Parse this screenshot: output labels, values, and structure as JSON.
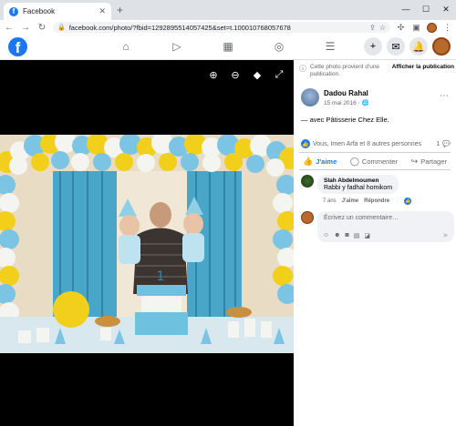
{
  "browser": {
    "tab_title": "Facebook",
    "tab_favicon": "f",
    "url": "facebook.com/photo/?fbid=1292895514057425&set=t.100010768057678"
  },
  "fb": {
    "logo": "f"
  },
  "side": {
    "notice_text": "Cette photo provient d'une publication.",
    "notice_link": "Afficher la publication",
    "author_name": "Dadou Rahal",
    "post_date": "15 mai 2016 · ",
    "caption": "— avec Pâtisserie Chez Elle.",
    "reactions_text": "Vous, Imen Arfa et 8 autres personnes",
    "reactions_count": "1",
    "like_label": "J'aime",
    "comment_label": "Commenter",
    "share_label": "Partager",
    "comment": {
      "name": "Slah Abdelmoumen",
      "text": "Rabbi y fadhal homikom",
      "age": "7 ans",
      "like": "J'aime",
      "reply": "Répondre"
    },
    "write_placeholder": "Écrivez un commentaire…"
  },
  "colors": {
    "brand": "#1877f2",
    "balloon_white": "#f4f4f0",
    "balloon_blue": "#7cc4e3",
    "balloon_yellow": "#f2cf1a",
    "curtain": "#4aa6c8"
  }
}
